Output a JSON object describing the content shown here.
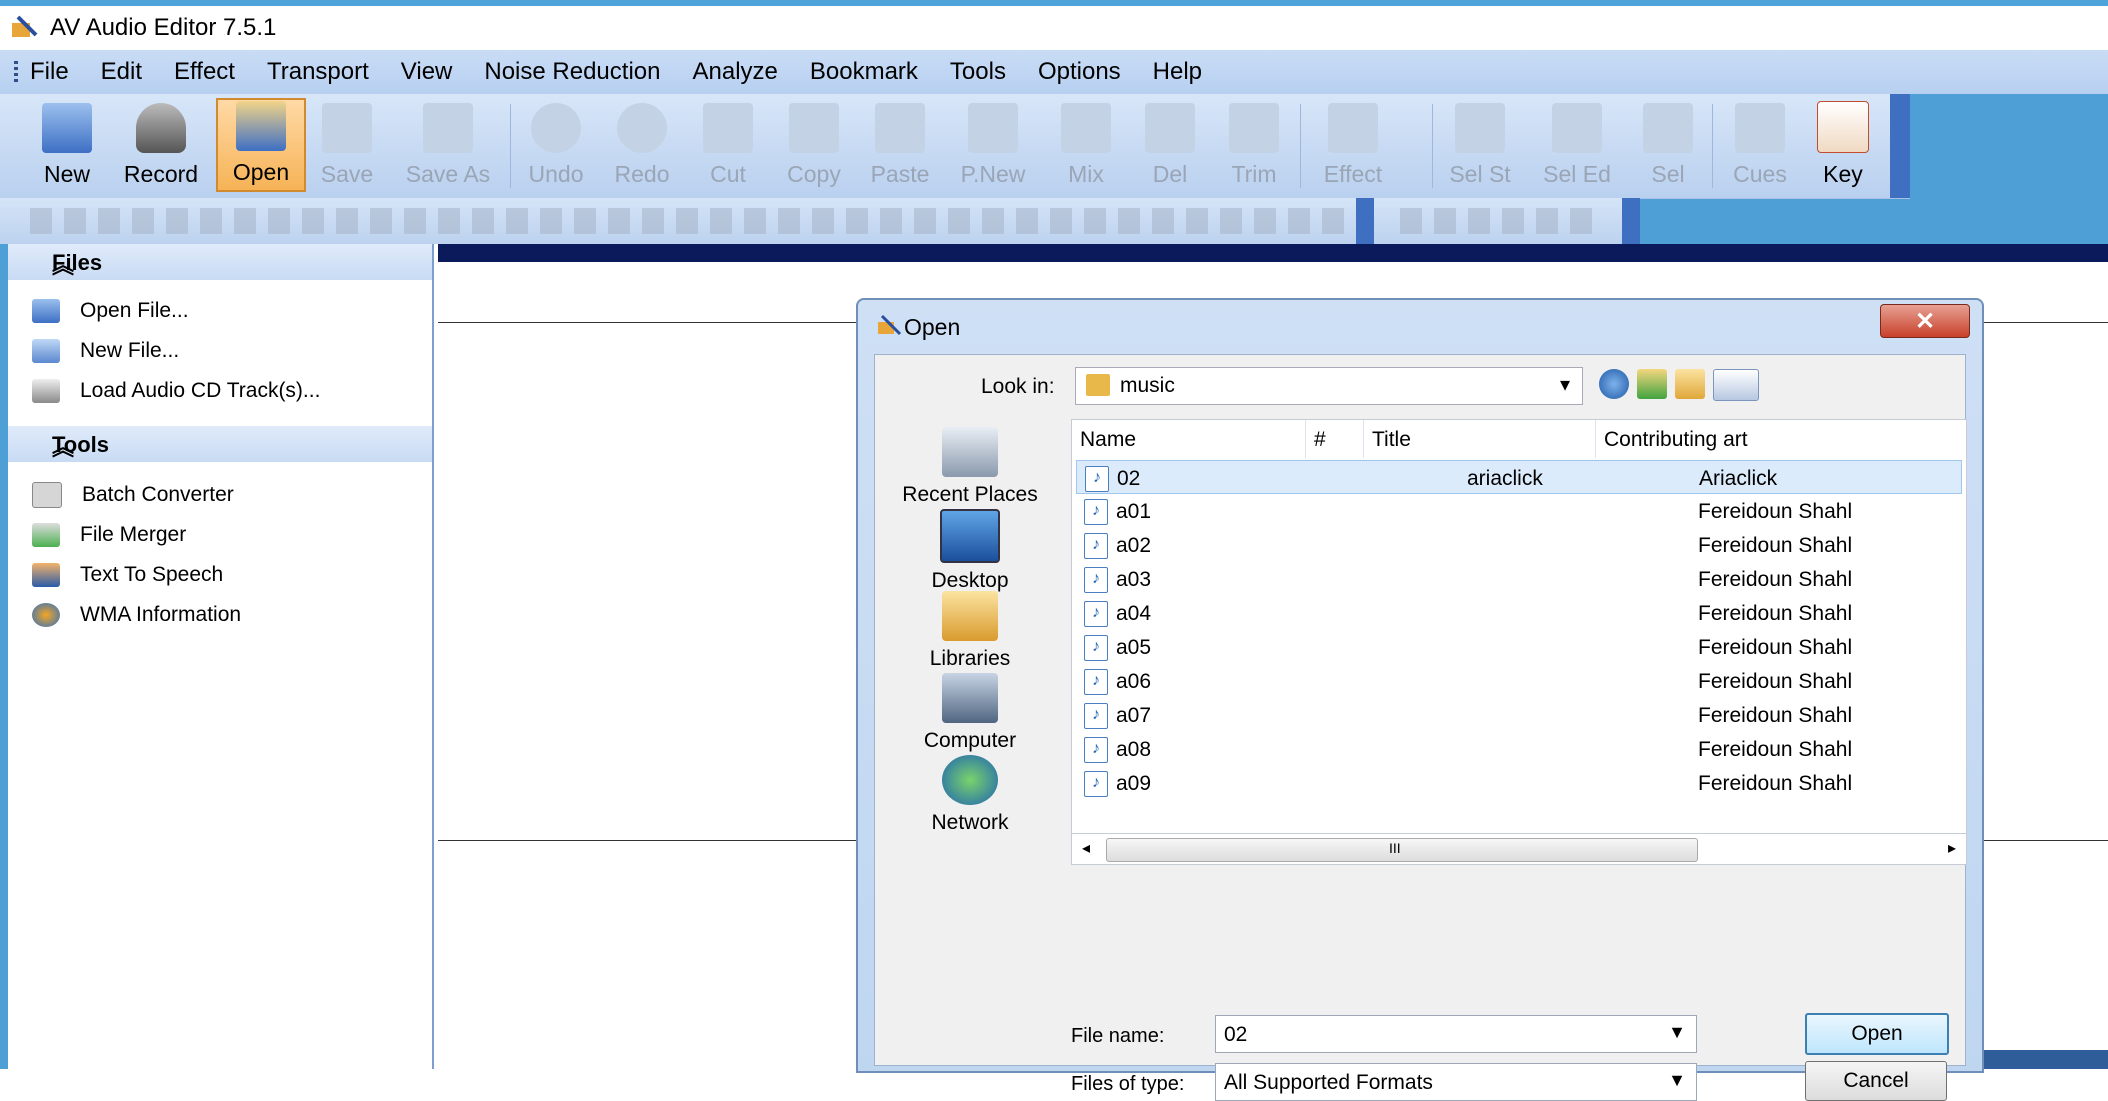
{
  "window": {
    "title": "AV Audio Editor 7.5.1"
  },
  "menu": [
    "File",
    "Edit",
    "Effect",
    "Transport",
    "View",
    "Noise Reduction",
    "Analyze",
    "Bookmark",
    "Tools",
    "Options",
    "Help"
  ],
  "toolbar": [
    {
      "label": "New",
      "state": "normal"
    },
    {
      "label": "Record",
      "state": "normal"
    },
    {
      "label": "Open",
      "state": "active"
    },
    {
      "label": "Save",
      "state": "disabled"
    },
    {
      "label": "Save As",
      "state": "disabled"
    },
    {
      "label": "Undo",
      "state": "disabled"
    },
    {
      "label": "Redo",
      "state": "disabled"
    },
    {
      "label": "Cut",
      "state": "disabled"
    },
    {
      "label": "Copy",
      "state": "disabled"
    },
    {
      "label": "Paste",
      "state": "disabled"
    },
    {
      "label": "P.New",
      "state": "disabled"
    },
    {
      "label": "Mix",
      "state": "disabled"
    },
    {
      "label": "Del",
      "state": "disabled"
    },
    {
      "label": "Trim",
      "state": "disabled"
    },
    {
      "label": "Effect",
      "state": "disabled"
    },
    {
      "label": "Sel St",
      "state": "disabled"
    },
    {
      "label": "Sel Ed",
      "state": "disabled"
    },
    {
      "label": "Sel",
      "state": "disabled"
    },
    {
      "label": "Cues",
      "state": "disabled"
    },
    {
      "label": "Key",
      "state": "normal"
    }
  ],
  "left_panel": {
    "files_header": "Files",
    "files": [
      "Open File...",
      "New File...",
      "Load Audio CD Track(s)..."
    ],
    "tools_header": "Tools",
    "tools": [
      "Batch Converter",
      "File Merger",
      "Text To Speech",
      "WMA Information"
    ]
  },
  "dialog": {
    "title": "Open",
    "close": "✕",
    "look_in_label": "Look in:",
    "look_in_value": "music",
    "places": [
      "Recent Places",
      "Desktop",
      "Libraries",
      "Computer",
      "Network"
    ],
    "columns": [
      "Name",
      "#",
      "Title",
      "Contributing art"
    ],
    "files": [
      {
        "name": "02",
        "num": "",
        "title": "ariaclick",
        "artist": "Ariaclick"
      },
      {
        "name": "a01",
        "num": "",
        "title": "",
        "artist": "Fereidoun Shahl"
      },
      {
        "name": "a02",
        "num": "",
        "title": "",
        "artist": "Fereidoun Shahl"
      },
      {
        "name": "a03",
        "num": "",
        "title": "",
        "artist": "Fereidoun Shahl"
      },
      {
        "name": "a04",
        "num": "",
        "title": "",
        "artist": "Fereidoun Shahl"
      },
      {
        "name": "a05",
        "num": "",
        "title": "",
        "artist": "Fereidoun Shahl"
      },
      {
        "name": "a06",
        "num": "",
        "title": "",
        "artist": "Fereidoun Shahl"
      },
      {
        "name": "a07",
        "num": "",
        "title": "",
        "artist": "Fereidoun Shahl"
      },
      {
        "name": "a08",
        "num": "",
        "title": "",
        "artist": "Fereidoun Shahl"
      },
      {
        "name": "a09",
        "num": "",
        "title": "",
        "artist": "Fereidoun Shahl"
      }
    ],
    "file_name_label": "File name:",
    "file_name_value": "02",
    "file_type_label": "Files of type:",
    "file_type_value": "All Supported Formats",
    "open_button": "Open",
    "cancel_button": "Cancel",
    "scroll_grip": "III"
  },
  "colors": {
    "accent": "#4d9fd6",
    "menubar": "#c9dcf5",
    "active_button": "#f6b356",
    "workspace_bar": "#0a1a5a",
    "close_button": "#c8402b"
  }
}
